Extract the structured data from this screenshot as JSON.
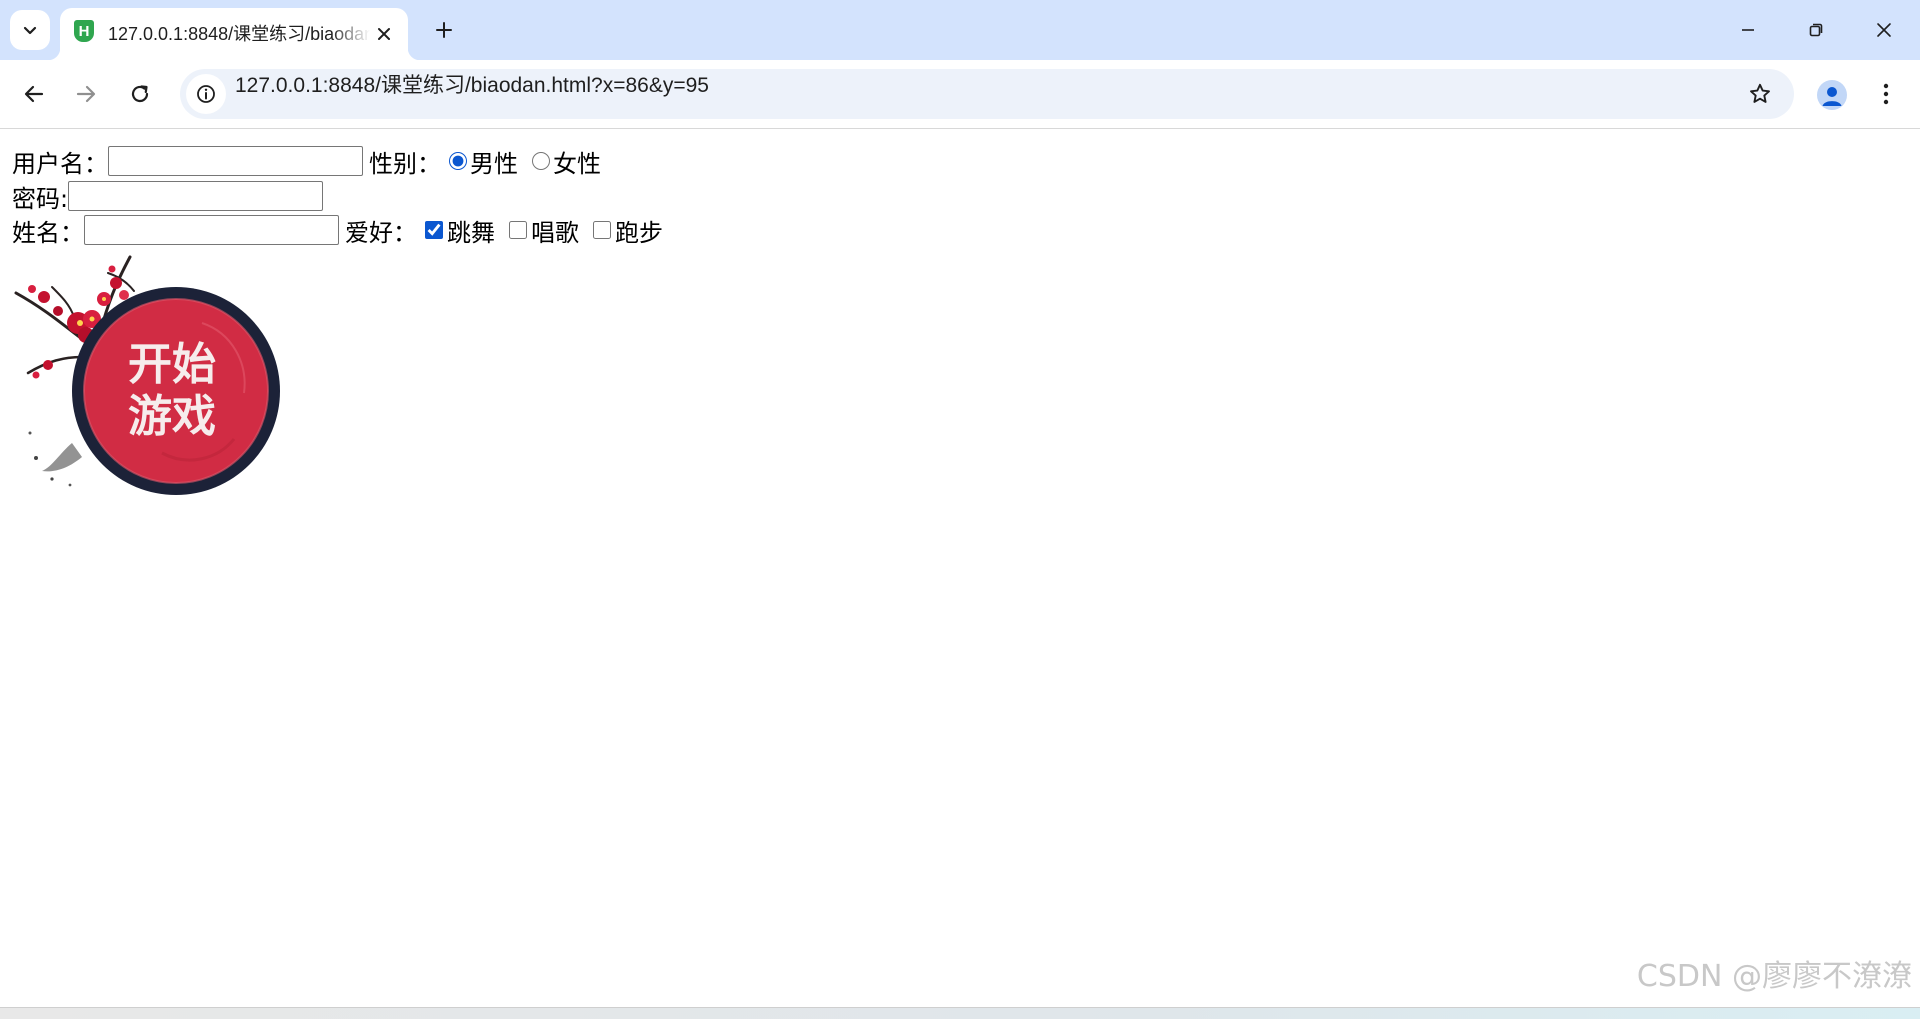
{
  "browser": {
    "tab": {
      "title": "127.0.0.1:8848/课堂练习/biaodan.html?x=86&y=95",
      "favicon_letter": "H"
    },
    "address": {
      "url": "127.0.0.1:8848/课堂练习/biaodan.html?x=86&y=95"
    },
    "icons": {
      "tab_search": "chevron-down-icon",
      "close": "close-icon",
      "new_tab": "plus-icon",
      "minimize": "minimize-icon",
      "restore": "restore-icon",
      "window_close": "close-icon",
      "back": "arrow-left-icon",
      "forward": "arrow-right-icon",
      "reload": "reload-icon",
      "site_info": "info-icon",
      "bookmark": "star-icon",
      "profile": "profile-icon",
      "menu": "more-vertical-icon"
    }
  },
  "form": {
    "username_label": "用户名：",
    "gender_label": "性别：",
    "gender_options": [
      {
        "label": "男性",
        "checked": true
      },
      {
        "label": "女性",
        "checked": false
      }
    ],
    "password_label": "密码:",
    "name_label": "姓名：",
    "hobby_label": "爱好：",
    "hobby_options": [
      {
        "label": "跳舞",
        "checked": true
      },
      {
        "label": "唱歌",
        "checked": false
      },
      {
        "label": "跑步",
        "checked": false
      }
    ]
  },
  "start_button": {
    "line1": "开始",
    "line2": "游戏"
  },
  "watermark": "CSDN @廖廖不潦潦",
  "colors": {
    "tabstrip": "#d3e3fd",
    "omnibox": "#edf2fa",
    "accent": "#0b57d0",
    "button_red": "#d12c44",
    "button_ring": "#1c2238"
  }
}
